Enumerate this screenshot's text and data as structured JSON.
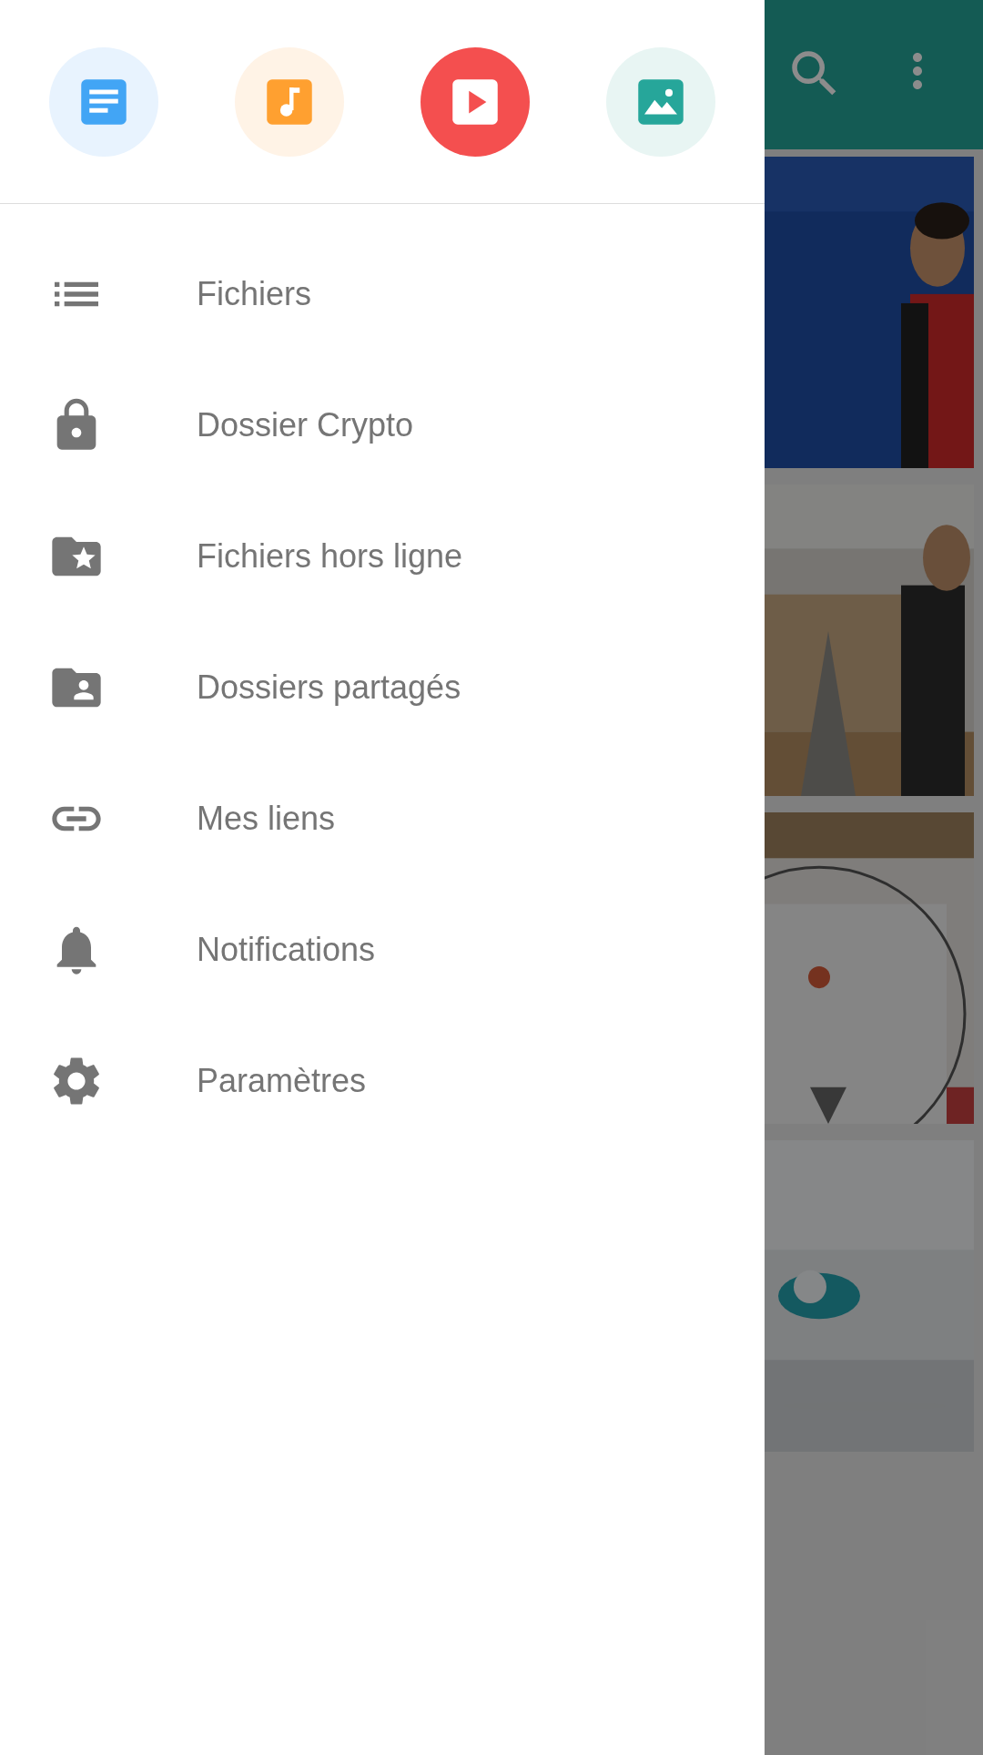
{
  "categories": [
    {
      "kind": "documents",
      "selected": false
    },
    {
      "kind": "music",
      "selected": false
    },
    {
      "kind": "video",
      "selected": true
    },
    {
      "kind": "images",
      "selected": false
    }
  ],
  "menu": [
    {
      "kind": "files",
      "label": "Fichiers"
    },
    {
      "kind": "crypto",
      "label": "Dossier Crypto"
    },
    {
      "kind": "offline",
      "label": "Fichiers hors ligne"
    },
    {
      "kind": "shared",
      "label": "Dossiers partagés"
    },
    {
      "kind": "links",
      "label": "Mes liens"
    },
    {
      "kind": "notifications",
      "label": "Notifications"
    },
    {
      "kind": "settings",
      "label": "Paramètres"
    }
  ]
}
